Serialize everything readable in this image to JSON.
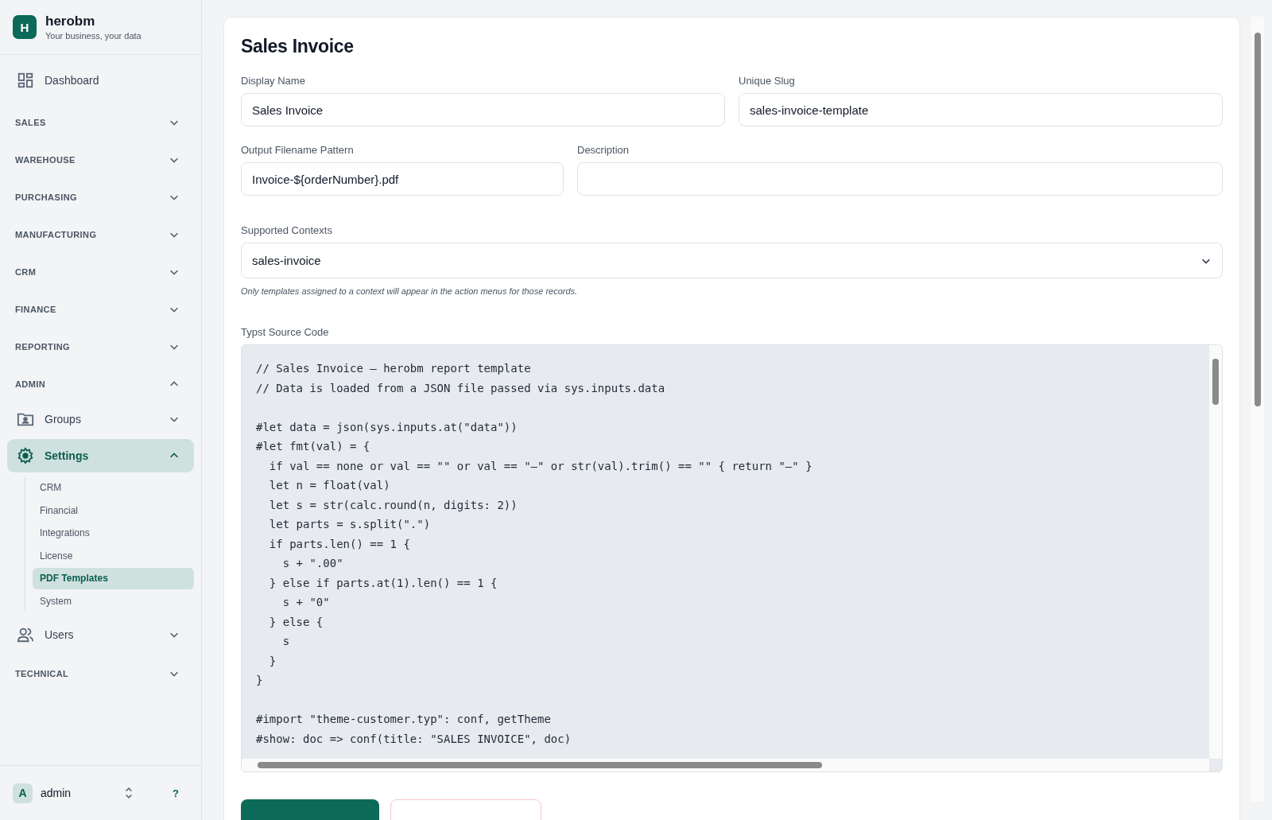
{
  "brand": {
    "initial": "H",
    "name": "herobm",
    "tagline": "Your business, your data"
  },
  "nav": [
    {
      "kind": "link",
      "label": "Dashboard"
    },
    {
      "kind": "section",
      "label": "SALES",
      "expanded": false
    },
    {
      "kind": "section",
      "label": "WAREHOUSE",
      "expanded": false
    },
    {
      "kind": "section",
      "label": "PURCHASING",
      "expanded": false
    },
    {
      "kind": "section",
      "label": "MANUFACTURING",
      "expanded": false
    },
    {
      "kind": "section",
      "label": "CRM",
      "expanded": false
    },
    {
      "kind": "section",
      "label": "FINANCE",
      "expanded": false
    },
    {
      "kind": "section",
      "label": "REPORTING",
      "expanded": false
    },
    {
      "kind": "section",
      "label": "ADMIN",
      "expanded": true
    },
    {
      "kind": "group",
      "label": "Groups",
      "expanded": false,
      "selected": false
    },
    {
      "kind": "group",
      "label": "Settings",
      "expanded": true,
      "selected": true,
      "children": [
        {
          "label": "CRM",
          "selected": false
        },
        {
          "label": "Financial",
          "selected": false
        },
        {
          "label": "Integrations",
          "selected": false
        },
        {
          "label": "License",
          "selected": false
        },
        {
          "label": "PDF Templates",
          "selected": true
        },
        {
          "label": "System",
          "selected": false
        }
      ]
    },
    {
      "kind": "group",
      "label": "Users",
      "expanded": false,
      "selected": false
    },
    {
      "kind": "section",
      "label": "TECHNICAL",
      "expanded": false
    }
  ],
  "user": {
    "initial": "A",
    "name": "admin",
    "help": "?"
  },
  "form": {
    "title": "Sales Invoice",
    "display_name": {
      "label": "Display Name",
      "value": "Sales Invoice"
    },
    "unique_slug": {
      "label": "Unique Slug",
      "value": "sales-invoice-template"
    },
    "output_filename": {
      "label": "Output Filename Pattern",
      "value": "Invoice-${orderNumber}.pdf"
    },
    "description": {
      "label": "Description"
    },
    "supported_contexts": {
      "label": "Supported Contexts",
      "value": "sales-invoice",
      "hint": "Only templates assigned to a context will appear in the action menus for those records."
    },
    "source": {
      "label": "Typst Source Code",
      "code": "// Sales Invoice — herobm report template\n// Data is loaded from a JSON file passed via sys.inputs.data\n\n#let data = json(sys.inputs.at(\"data\"))\n#let fmt(val) = {\n  if val == none or val == \"\" or val == \"—\" or str(val).trim() == \"\" { return \"—\" }\n  let n = float(val)\n  let s = str(calc.round(n, digits: 2))\n  let parts = s.split(\".\")\n  if parts.len() == 1 {\n    s + \".00\"\n  } else if parts.at(1).len() == 1 {\n    s + \"0\"\n  } else {\n    s\n  }\n}\n\n#import \"theme-customer.typ\": conf, getTheme\n#show: doc => conf(title: \"SALES INVOICE\", doc)"
    }
  }
}
